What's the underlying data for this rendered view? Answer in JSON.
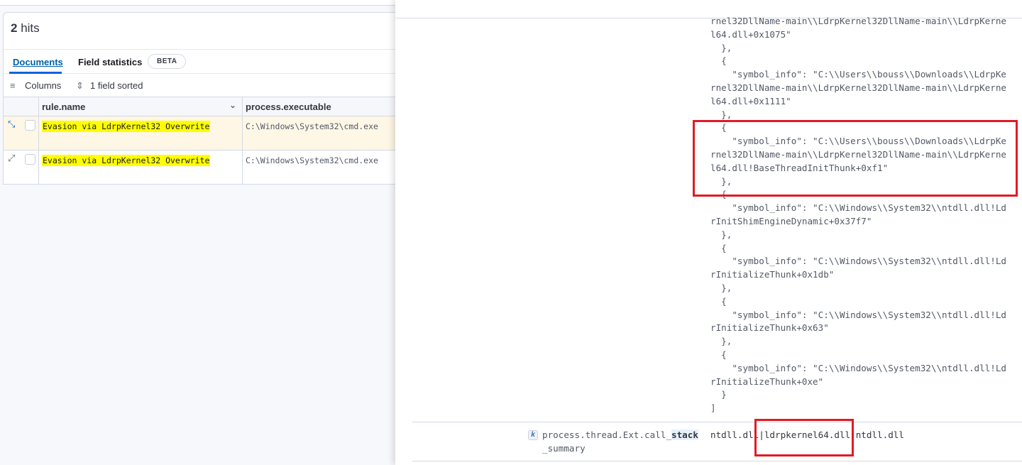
{
  "results": {
    "hits_count": "2",
    "hits_label": "hits",
    "tabs": [
      {
        "label": "Documents"
      },
      {
        "label": "Field statistics"
      }
    ],
    "beta_badge": "BETA",
    "toolbar": {
      "columns": "Columns",
      "sorted": "1 field sorted"
    },
    "columns": [
      "rule.name",
      "process.executable"
    ],
    "rows": [
      {
        "rule_name": "Evasion via LdrpKernel32 Overwrite",
        "executable": "C:\\Windows\\System32\\cmd.exe",
        "expanded": true
      },
      {
        "rule_name": "Evasion via LdrpKernel32 Overwrite",
        "executable": "C:\\Windows\\System32\\cmd.exe",
        "expanded": false
      }
    ]
  },
  "flyout": {
    "code_lines": [
      "rnel32DllName-main\\\\LdrpKernel32DllName-main\\\\LdrpKerne",
      "l64.dll+0x1075\"",
      "  },",
      "  {",
      "    \"symbol_info\": \"C:\\\\Users\\\\bouss\\\\Downloads\\\\LdrpKe",
      "rnel32DllName-main\\\\LdrpKernel32DllName-main\\\\LdrpKerne",
      "l64.dll+0x1111\"",
      "  },",
      "  {",
      "    \"symbol_info\": \"C:\\\\Users\\\\bouss\\\\Downloads\\\\LdrpKe",
      "rnel32DllName-main\\\\LdrpKernel32DllName-main\\\\LdrpKerne",
      "l64.dll!BaseThreadInitThunk+0xf1\"",
      "  },",
      "  {",
      "    \"symbol_info\": \"C:\\\\Windows\\\\System32\\\\ntdll.dll!Ld",
      "rInitShimEngineDynamic+0x37f7\"",
      "  },",
      "  {",
      "    \"symbol_info\": \"C:\\\\Windows\\\\System32\\\\ntdll.dll!Ld",
      "rInitializeThunk+0x1db\"",
      "  },",
      "  {",
      "    \"symbol_info\": \"C:\\\\Windows\\\\System32\\\\ntdll.dll!Ld",
      "rInitializeThunk+0x63\"",
      "  },",
      "  {",
      "    \"symbol_info\": \"C:\\\\Windows\\\\System32\\\\ntdll.dll!Ld",
      "rInitializeThunk+0xe\"",
      "  }",
      "]"
    ],
    "field": {
      "type_icon": "k",
      "name_prefix": "process.thread.Ext.call_",
      "name_match": "stack",
      "name_suffix": "_summary",
      "value": "ntdll.dll|ldrpkernel64.dll|ntdll.dll"
    },
    "highlight_color": "#e01b24"
  }
}
